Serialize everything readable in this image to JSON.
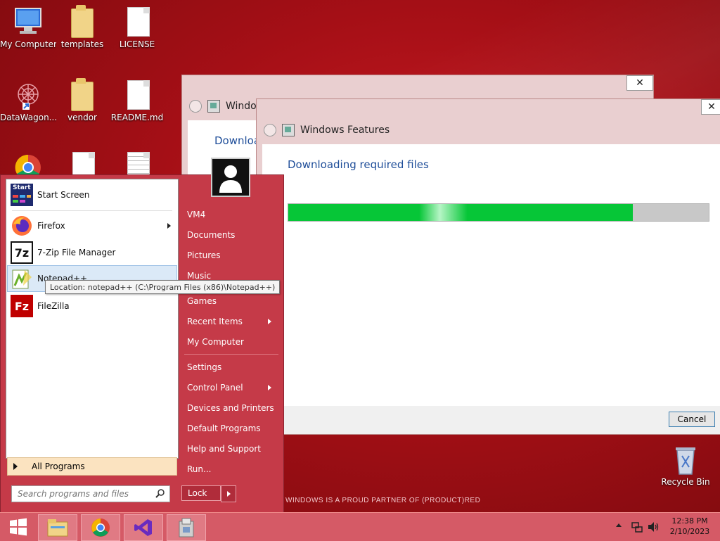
{
  "desktop": {
    "icons": [
      {
        "label": "My Computer",
        "icon": "computer-icon"
      },
      {
        "label": "templates",
        "icon": "folder-icon"
      },
      {
        "label": "LICENSE",
        "icon": "file-icon"
      },
      {
        "label": "DataWagon...",
        "icon": "datawagon-icon"
      },
      {
        "label": "vendor",
        "icon": "folder-icon"
      },
      {
        "label": "README.md",
        "icon": "file-icon"
      },
      {
        "label": "Recycle Bin",
        "icon": "recycle-bin-icon"
      }
    ],
    "wallpaper_text": "WINDOWS IS A PROUD PARTNER OF (PRODUCT)RED"
  },
  "back_window": {
    "title": "Windo",
    "body_text": "Downloa",
    "close": "✕"
  },
  "front_window": {
    "title": "Windows Features",
    "heading": "Downloading required files",
    "progress": 0.82,
    "cancel_label": "Cancel",
    "close": "✕"
  },
  "start_menu": {
    "programs": [
      {
        "label": "Start Screen",
        "icon": "start-screen-icon",
        "has_submenu": false
      },
      {
        "label": "Firefox",
        "icon": "firefox-icon",
        "has_submenu": true
      },
      {
        "label": "7-Zip File Manager",
        "icon": "7zip-icon",
        "has_submenu": false
      },
      {
        "label": "Notepad++",
        "icon": "notepadpp-icon",
        "has_submenu": false,
        "selected": true
      },
      {
        "label": "FileZilla",
        "icon": "filezilla-icon",
        "has_submenu": false
      }
    ],
    "start_screen_icon_text": "Start",
    "sevenzip_icon_text": "7z",
    "filezilla_icon_text": "Fz",
    "tooltip": "Location: notepad++ (C:\\Program Files (x86)\\Notepad++)",
    "all_programs": "All Programs",
    "search_placeholder": "Search programs and files",
    "right_items": [
      {
        "label": "VM4",
        "has_submenu": false
      },
      {
        "label": "Documents",
        "has_submenu": false
      },
      {
        "label": "Pictures",
        "has_submenu": false
      },
      {
        "label": "Music",
        "has_submenu": false
      },
      {
        "label": "Games",
        "has_submenu": false
      },
      {
        "label": "Recent Items",
        "has_submenu": true
      },
      {
        "label": "My Computer",
        "has_submenu": false
      },
      {
        "label": "Settings",
        "has_submenu": false
      },
      {
        "label": "Control Panel",
        "has_submenu": true
      },
      {
        "label": "Devices and Printers",
        "has_submenu": false
      },
      {
        "label": "Default Programs",
        "has_submenu": false
      },
      {
        "label": "Help and Support",
        "has_submenu": false
      },
      {
        "label": "Run...",
        "has_submenu": false
      }
    ],
    "lock_label": "Lock"
  },
  "taskbar": {
    "apps": [
      {
        "name": "file-explorer-icon"
      },
      {
        "name": "chrome-icon"
      },
      {
        "name": "visual-studio-icon"
      },
      {
        "name": "installer-icon"
      }
    ],
    "clock_time": "12:38 PM",
    "clock_date": "2/10/2023"
  },
  "colors": {
    "accent_red": "#c53a48",
    "progress_green": "#06c637",
    "heading_blue": "#1f4e99"
  }
}
